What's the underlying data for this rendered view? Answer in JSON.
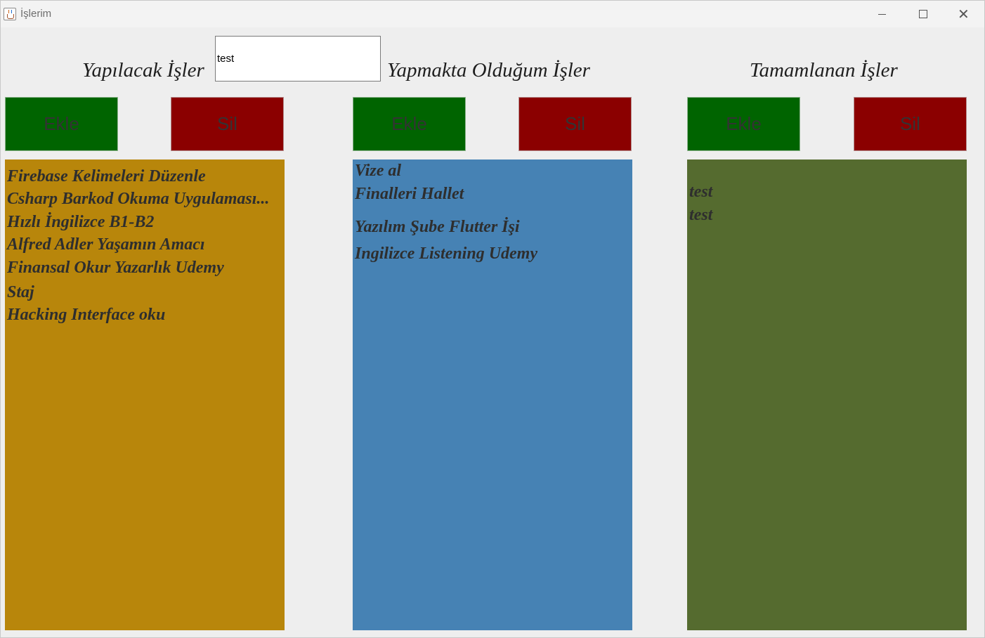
{
  "window": {
    "title": "İşlerim",
    "minimize_icon": "minimize-icon",
    "maximize_icon": "maximize-icon",
    "close_icon": "close-icon"
  },
  "colors": {
    "todo_list": "#b8860b",
    "doing_list": "#4682b4",
    "done_list": "#556b2f",
    "add_button": "#006400",
    "delete_button": "#8b0000"
  },
  "input": {
    "value": "test"
  },
  "columns": {
    "todo": {
      "header": "Yapılacak İşler",
      "add_label": "Ekle",
      "delete_label": "Sil",
      "items": [
        "Firebase Kelimeleri Düzenle",
        "Csharp Barkod Okuma Uygulaması...",
        "Hızlı İngilizce B1-B2",
        "Alfred Adler Yaşamın Amacı",
        "Finansal Okur Yazarlık Udemy",
        "Staj",
        "Hacking Interface oku"
      ]
    },
    "doing": {
      "header": "Yapmakta Olduğum İşler",
      "add_label": "Ekle",
      "delete_label": "Sil",
      "items": [
        "Vize al",
        "Finalleri Hallet",
        "Yazılım Şube Flutter İşi",
        "Ingilizce Listening Udemy"
      ]
    },
    "done": {
      "header": "Tamamlanan İşler",
      "add_label": "Ekle",
      "delete_label": "Sil",
      "items": [
        "test",
        "test"
      ]
    }
  }
}
